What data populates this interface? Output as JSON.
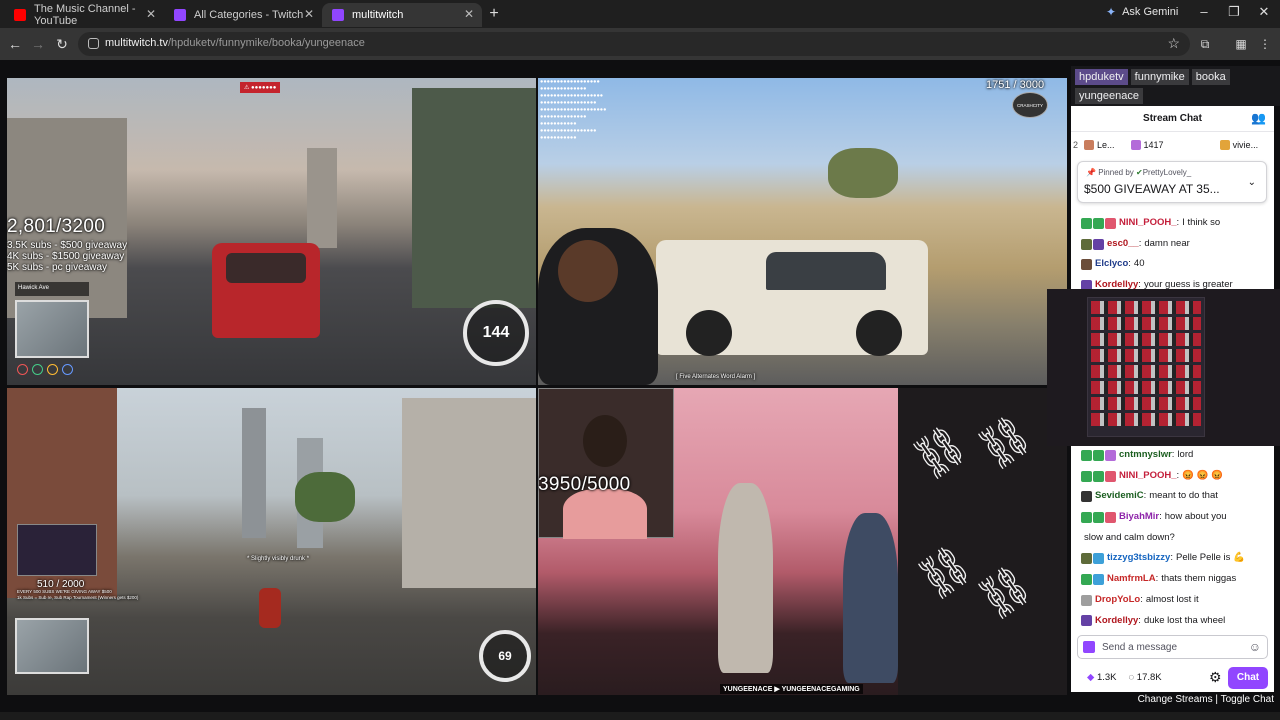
{
  "browser": {
    "tabs": [
      {
        "title": "The Music Channel - YouTube",
        "favicon_color": "#ff0000"
      },
      {
        "title": "All Categories - Twitch",
        "favicon_color": "#9146ff"
      },
      {
        "title": "multitwitch",
        "favicon_color": "#9146ff"
      }
    ],
    "gemini_label": "Ask Gemini",
    "url_domain": "multitwitch.tv",
    "url_path": "/hpduketv/funnymike/booka/yungeenace"
  },
  "streams": {
    "s1": {
      "goal_count": "2,801/3200",
      "goal_lines": [
        "3.5K subs - $500 giveaway",
        "4K subs - $1500 giveaway",
        "5K subs - pc giveaway"
      ],
      "speed": "144",
      "street": "Hawick Ave"
    },
    "s2": {
      "goal_count": "1751 / 3000",
      "logo_text": "CRASHCITY",
      "caption": "[ Five Alternates Word Alarm ]"
    },
    "s3": {
      "goal_count": "510 / 2000",
      "goal_lines": [
        "EVERY 500 SUBS WE'RE GIVING AWAY $500",
        "1k Subs = Sub re, Sub Rap Tournament (Winners gets $200)"
      ],
      "speed": "69",
      "caption": "* Slightly visibly drunk *"
    },
    "s4": {
      "goal_count": "3950/5000",
      "social_handle": "YUNGEENACE",
      "social_handle2": "YUNGEENACEGAMING"
    }
  },
  "chat": {
    "channel_tabs": [
      "hpduketv",
      "funnymike",
      "booka",
      "yungeenace"
    ],
    "active_tab": 0,
    "title": "Stream Chat",
    "leaderboard": [
      {
        "rank": "2",
        "name": "Le...",
        "color": "#c97d5d"
      },
      {
        "rank": "",
        "name": "1417",
        "color": "#b36bd9"
      },
      {
        "rank": "",
        "name": "vivie...",
        "color": "#e2a43a"
      }
    ],
    "pinned": {
      "by_prefix": "Pinned by",
      "by_user": "PrettyLovely_",
      "message": "$500 GIVEAWAY AT 35..."
    },
    "messages_top": [
      {
        "user": "NINI_POOH_",
        "color": "#c41f3b",
        "text": "I think so",
        "badges": [
          "#34a853",
          "#34a853",
          "#e0566e"
        ]
      },
      {
        "user": "esc0__",
        "color": "#b0161e",
        "text": "damn near",
        "badges": [
          "#5e6b3a",
          "#6441a5"
        ]
      },
      {
        "user": "Elclyco",
        "color": "#1f3b8a",
        "text": "40",
        "badges": [
          "#6b4d3a"
        ]
      },
      {
        "user": "Kordellyy",
        "color": "#b0161e",
        "text": "your guess is greater",
        "badges": [
          "#6441a5"
        ]
      }
    ],
    "messages_bottom": [
      {
        "user": "cntmnyslwr",
        "color": "#1b5e20",
        "text": "lord",
        "badges": [
          "#34a853",
          "#34a853",
          "#b36bd9"
        ]
      },
      {
        "user": "NINI_POOH_",
        "color": "#c41f3b",
        "text": "😡 😡 😡",
        "badges": [
          "#34a853",
          "#34a853",
          "#e0566e"
        ]
      },
      {
        "user": "SevidemiC",
        "color": "#1b5e20",
        "text": "meant to do that",
        "badges": [
          "#333333"
        ]
      },
      {
        "user": "BiyahMir",
        "color": "#8e24aa",
        "text": "how about you",
        "badges": [
          "#34a853",
          "#34a853",
          "#e0566e"
        ]
      },
      {
        "user": "",
        "color": "#18181b",
        "text": "slow and calm down?",
        "badges": []
      },
      {
        "user": "tizzyg3tsbizzy",
        "color": "#1565c0",
        "text": "Pelle Pelle is 💪",
        "badges": [
          "#5e6b3a",
          "#3da0d8"
        ]
      },
      {
        "user": "NamfrmLA",
        "color": "#c62828",
        "text": "thats them niggas",
        "badges": [
          "#34a853",
          "#3da0d8"
        ]
      },
      {
        "user": "DropYoLo",
        "color": "#c62828",
        "text": "almost lost it",
        "badges": [
          "#9e9e9e"
        ]
      },
      {
        "user": "Kordellyy",
        "color": "#b0161e",
        "text": "duke lost tha wheel",
        "badges": [
          "#6441a5"
        ]
      }
    ],
    "input_placeholder": "Send a message",
    "points_1": "1.3K",
    "points_2": "17.8K",
    "chat_button": "Chat"
  },
  "footer": {
    "change_streams": "Change Streams",
    "separator": "|",
    "toggle_chat": "Toggle Chat"
  }
}
